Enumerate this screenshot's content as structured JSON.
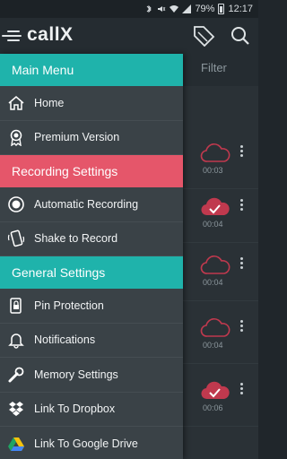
{
  "status_bar": {
    "battery": "79%",
    "time": "12:17"
  },
  "app": {
    "title": "callX"
  },
  "tabs": {
    "filter": "Filter"
  },
  "recordings": [
    {
      "duration": "00:03",
      "saved": false
    },
    {
      "duration": "00:04",
      "saved": true
    },
    {
      "duration": "00:04",
      "saved": false
    },
    {
      "duration": "00:04",
      "saved": false
    },
    {
      "duration": "00:06",
      "saved": true
    }
  ],
  "drawer": {
    "main_menu": {
      "title": "Main Menu",
      "items": [
        {
          "label": "Home",
          "icon": "home-icon"
        },
        {
          "label": "Premium Version",
          "icon": "award-icon"
        }
      ]
    },
    "recording_settings": {
      "title": "Recording Settings",
      "items": [
        {
          "label": "Automatic Recording",
          "icon": "radio-icon"
        },
        {
          "label": "Shake to Record",
          "icon": "shake-phone-icon"
        }
      ]
    },
    "general_settings": {
      "title": "General Settings",
      "items": [
        {
          "label": "Pin Protection",
          "icon": "lock-phone-icon"
        },
        {
          "label": "Notifications",
          "icon": "bell-icon"
        },
        {
          "label": "Memory Settings",
          "icon": "wrench-icon"
        },
        {
          "label": "Link To Dropbox",
          "icon": "dropbox-icon"
        },
        {
          "label": "Link To Google Drive",
          "icon": "google-drive-icon"
        }
      ]
    }
  },
  "colors": {
    "teal": "#1fb3ab",
    "red": "#e5566a",
    "drawer_bg": "#3a4247",
    "cloud": "#c0394e"
  }
}
